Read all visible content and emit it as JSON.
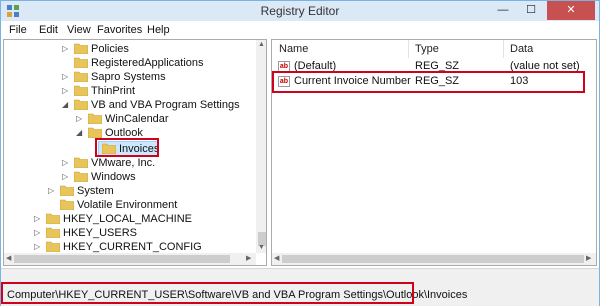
{
  "window": {
    "title": "Registry Editor",
    "min_glyph": "—",
    "max_glyph": "☐",
    "close_glyph": "✕"
  },
  "menu": [
    "File",
    "Edit",
    "View",
    "Favorites",
    "Help"
  ],
  "tree": {
    "items": [
      {
        "label": "Policies",
        "expander": "▷"
      },
      {
        "label": "RegisteredApplications",
        "expander": ""
      },
      {
        "label": "Sapro Systems",
        "expander": "▷"
      },
      {
        "label": "ThinPrint",
        "expander": "▷"
      },
      {
        "label": "VB and VBA Program Settings",
        "expander": "◢"
      },
      {
        "label": "WinCalendar",
        "expander": "▷"
      },
      {
        "label": "Outlook",
        "expander": "◢"
      },
      {
        "label": "Invoices",
        "expander": ""
      },
      {
        "label": "VMware, Inc.",
        "expander": "▷"
      },
      {
        "label": "Windows",
        "expander": "▷"
      },
      {
        "label": "System",
        "expander": "▷"
      },
      {
        "label": "Volatile Environment",
        "expander": ""
      },
      {
        "label": "HKEY_LOCAL_MACHINE",
        "expander": "▷"
      },
      {
        "label": "HKEY_USERS",
        "expander": "▷"
      },
      {
        "label": "HKEY_CURRENT_CONFIG",
        "expander": "▷"
      }
    ]
  },
  "values": {
    "columns": [
      "Name",
      "Type",
      "Data"
    ],
    "rows": [
      {
        "name": "(Default)",
        "type": "REG_SZ",
        "data": "(value not set)",
        "icon": "ab"
      },
      {
        "name": "Current Invoice Number",
        "type": "REG_SZ",
        "data": "103",
        "icon": "ab"
      }
    ]
  },
  "statusbar": {
    "path": "Computer\\HKEY_CURRENT_USER\\Software\\VB and VBA Program Settings\\Outlook\\Invoices"
  },
  "colors": {
    "highlight": "#d0021b",
    "folder": "#e8c55a",
    "title_bar": "#dbe8f6"
  }
}
